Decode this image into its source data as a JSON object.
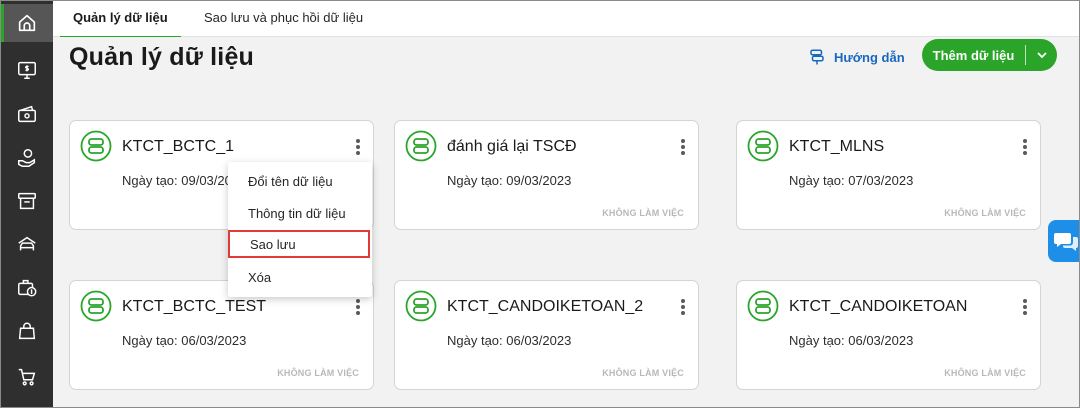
{
  "sidebar": {
    "items": [
      {
        "name": "home-icon"
      },
      {
        "name": "monitor-dollar-icon"
      },
      {
        "name": "wallet-icon"
      },
      {
        "name": "hand-money-icon"
      },
      {
        "name": "box-icon"
      },
      {
        "name": "car-icon"
      },
      {
        "name": "briefcase-dollar-icon"
      },
      {
        "name": "shopping-bag-icon"
      },
      {
        "name": "cart-icon"
      }
    ]
  },
  "tabs": [
    {
      "label": "Quản lý dữ liệu",
      "active": true
    },
    {
      "label": "Sao lưu và phục hồi dữ liệu",
      "active": false
    }
  ],
  "header": {
    "title": "Quản lý dữ liệu",
    "guide_label": "Hướng dẫn",
    "add_label": "Thêm dữ liệu"
  },
  "cards": [
    {
      "name": "KTCT_BCTC_1",
      "date": "Ngày tạo: 09/03/2023",
      "status": ""
    },
    {
      "name": "đánh giá lại TSCĐ",
      "date": "Ngày tạo: 09/03/2023",
      "status": "KHÔNG LÀM VIỆC"
    },
    {
      "name": "KTCT_MLNS",
      "date": "Ngày tạo: 07/03/2023",
      "status": "KHÔNG LÀM VIỆC"
    },
    {
      "name": "KTCT_BCTC_TEST",
      "date": "Ngày tạo: 06/03/2023",
      "status": "KHÔNG LÀM VIỆC"
    },
    {
      "name": "KTCT_CANDOIKETOAN_2",
      "date": "Ngày tạo: 06/03/2023",
      "status": "KHÔNG LÀM VIỆC"
    },
    {
      "name": "KTCT_CANDOIKETOAN",
      "date": "Ngày tạo: 06/03/2023",
      "status": "KHÔNG LÀM VIỆC"
    }
  ],
  "context_menu": {
    "items": [
      {
        "label": "Đổi tên dữ liệu"
      },
      {
        "label": "Thông tin dữ liệu"
      },
      {
        "label": "Sao lưu",
        "highlighted": true
      },
      {
        "label": "Xóa"
      }
    ]
  },
  "colors": {
    "accent_green": "#2aa52a",
    "link_blue": "#1669bf",
    "sidebar_bg": "#2f2f2f",
    "highlight_red": "#e03b3b",
    "chat_blue": "#1e8fe8"
  }
}
